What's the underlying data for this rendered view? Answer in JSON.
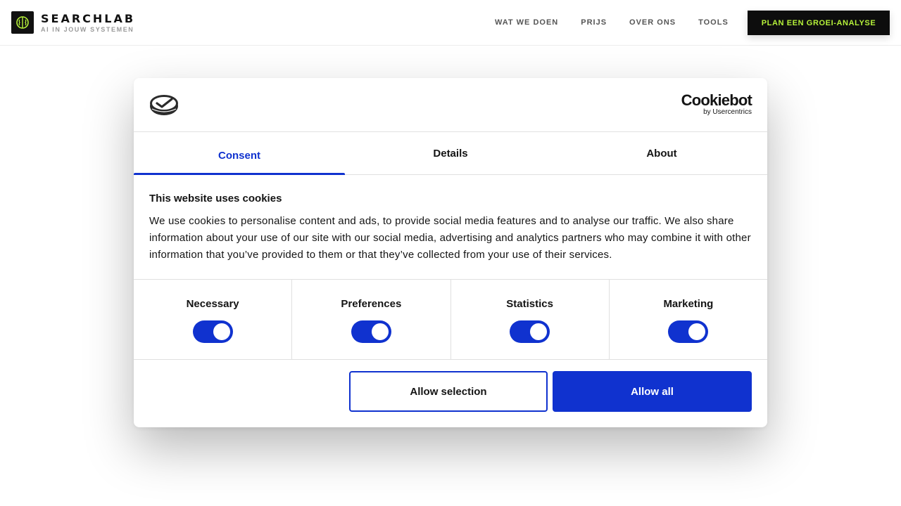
{
  "site": {
    "brand_name": "SEARCHLAB",
    "brand_tagline": "AI IN JOUW SYSTEMEN",
    "logo_icon": "brain-icon",
    "accent_color": "#b6f23a",
    "nav": [
      {
        "label": "WAT WE DOEN"
      },
      {
        "label": "PRIJS"
      },
      {
        "label": "OVER ONS"
      },
      {
        "label": "TOOLS"
      }
    ],
    "cta_label": "PLAN EEN GROEI-ANALYSE"
  },
  "consent_dialog": {
    "logo_icon": "cookiebot-logo-icon",
    "brand_name": "Cookiebot",
    "brand_sub": "by Usercentrics",
    "accent_color": "#1032cf",
    "tabs": [
      {
        "label": "Consent",
        "active": true
      },
      {
        "label": "Details",
        "active": false
      },
      {
        "label": "About",
        "active": false
      }
    ],
    "title": "This website uses cookies",
    "text": "We use cookies to personalise content and ads, to provide social media features and to analyse our traffic. We also share information about your use of our site with our social media, advertising and analytics partners who may combine it with other information that you’ve provided to them or that they’ve collected from your use of their services.",
    "categories": [
      {
        "label": "Necessary",
        "enabled": true
      },
      {
        "label": "Preferences",
        "enabled": true
      },
      {
        "label": "Statistics",
        "enabled": true
      },
      {
        "label": "Marketing",
        "enabled": true
      }
    ],
    "allow_selection_label": "Allow selection",
    "allow_all_label": "Allow all"
  }
}
